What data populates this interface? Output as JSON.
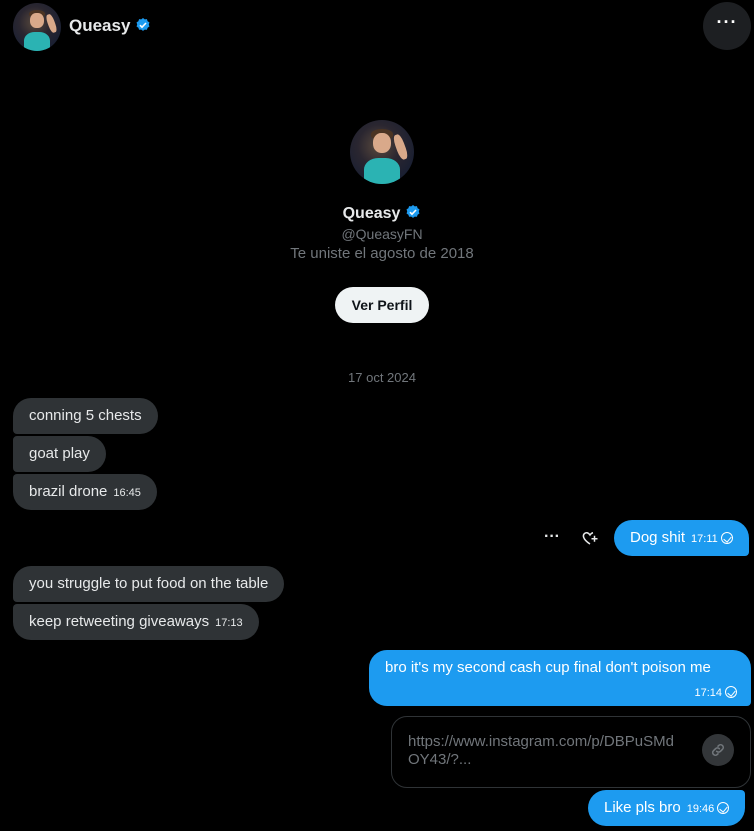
{
  "header": {
    "name": "Queasy",
    "more_icon": "more-horizontal-icon"
  },
  "profile": {
    "name": "Queasy",
    "handle": "@QueasyFN",
    "joined": "Te uniste el agosto de 2018",
    "view_profile": "Ver Perfil"
  },
  "conversation": {
    "date": "17 oct 2024",
    "messages": [
      {
        "from": "them",
        "text": "conning 5 chests",
        "time": ""
      },
      {
        "from": "them",
        "text": "goat play",
        "time": ""
      },
      {
        "from": "them",
        "text": "brazil drone",
        "time": "16:45"
      },
      {
        "from": "me",
        "text": "Dog shit",
        "time": "17:11"
      },
      {
        "from": "them",
        "text": "you struggle to put food on the table",
        "time": ""
      },
      {
        "from": "them",
        "text": "keep retweeting giveaways",
        "time": "17:13"
      },
      {
        "from": "me",
        "text": "bro it's my second cash cup final don't poison me",
        "time": "17:14"
      },
      {
        "from": "me",
        "text": "https://www.instagram.com/p/DBPuSMdOY43/?...",
        "time": ""
      },
      {
        "from": "me",
        "text": "Like pls bro",
        "time": "19:46"
      }
    ]
  },
  "colors": {
    "accent": "#1d9bf0",
    "incoming": "#2f3336",
    "background": "#000000"
  }
}
